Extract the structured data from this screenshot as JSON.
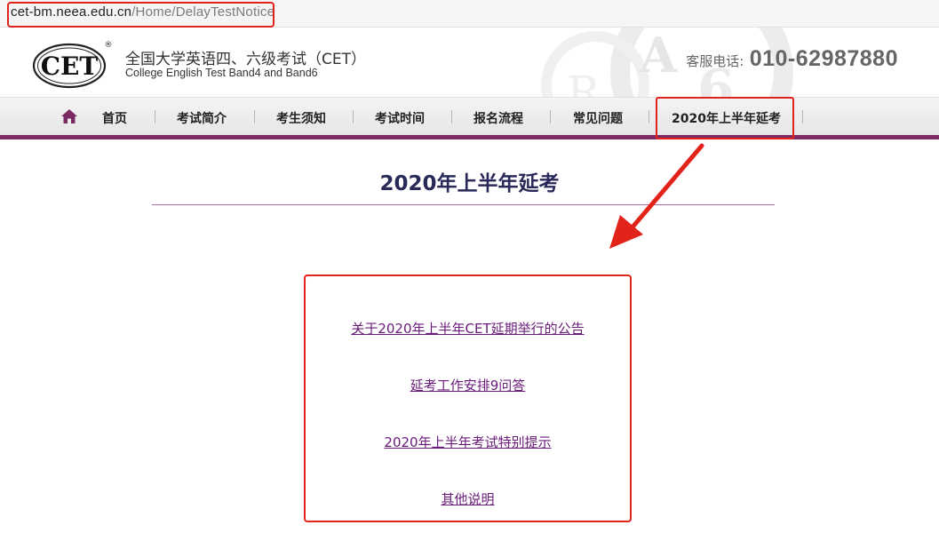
{
  "browser": {
    "url_host": "cet-bm.neea.edu.cn",
    "url_path": "/Home/DelayTestNotice"
  },
  "header": {
    "logo_text": "CET",
    "logo_mark": "®",
    "brand_cn": "全国大学英语四、六级考试（CET）",
    "brand_en": "College English Test Band4 and Band6",
    "hotline_label": "客服电话:",
    "hotline_number": "010-62987880"
  },
  "nav": {
    "home_icon": "home-icon",
    "items": [
      {
        "label": "首页"
      },
      {
        "label": "考试简介"
      },
      {
        "label": "考生须知"
      },
      {
        "label": "考试时间"
      },
      {
        "label": "报名流程"
      },
      {
        "label": "常见问题"
      },
      {
        "label": "2020年上半年延考",
        "active": true
      }
    ]
  },
  "main": {
    "title": "2020年上半年延考",
    "links": [
      {
        "label": "关于2020年上半年CET延期举行的公告"
      },
      {
        "label": "延考工作安排9问答"
      },
      {
        "label": "2020年上半年考试特别提示"
      },
      {
        "label": "其他说明"
      }
    ]
  },
  "colors": {
    "accent": "#7b2a63",
    "annotation": "#e2231a",
    "link": "#6a1b7a",
    "title": "#2a2a5a"
  }
}
